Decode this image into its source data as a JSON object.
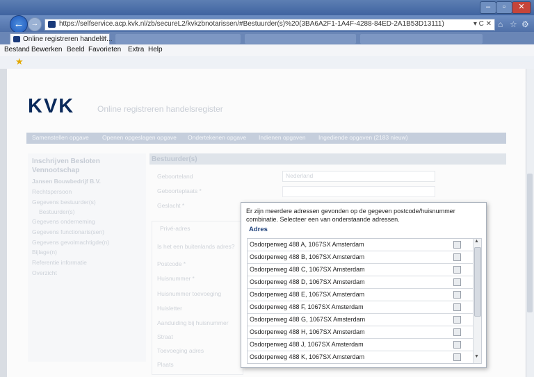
{
  "browser": {
    "url": "https://selfservice.acp.kvk.nl/zb/secureL2/kvkzbnotarissen/#Bestuurder(s)%20(3BA6A2F1-1A4F-4288-84ED-2A1B53D13111)",
    "url_controls": "▾ C ✕",
    "tab_title": "Online registreren handelsr...",
    "menu": [
      "Bestand",
      "Bewerken",
      "Beeld",
      "Favorieten",
      "Extra",
      "Help"
    ]
  },
  "header": {
    "logo": "KVK",
    "subtitle": "Online registreren handelsregister"
  },
  "steps": [
    "Samenstellen opgave",
    "Openen opgeslagen opgave",
    "Ondertekenen opgave",
    "Indienen opgaven",
    "Ingediende opgaven (2183 nieuw)"
  ],
  "left_panel": {
    "heading": "Inschrijven Besloten Vennootschap",
    "items": [
      "Jansen Bouwbedrijf B.V.",
      "Rechtspersoon",
      "Gegevens bestuurder(s)",
      "Bestuurder(s)",
      "Gegevens onderneming",
      "Gegevens functionaris(sen)",
      "Gegevens gevolmachtigde(n)",
      "Bijlage(n)",
      "Referentie informatie",
      "Overzicht"
    ]
  },
  "form": {
    "section_title": "Bestuurder(s)",
    "labels": [
      "Geboorteland",
      "Geboorteplaats *",
      "Geslacht *",
      "Privé-adres",
      "Is het een buitenlands adres?",
      "Postcode *",
      "Huisnummer *",
      "Huisnummer toevoeging",
      "Huisletter",
      "Aanduiding bij huisnummer",
      "Straat",
      "Toevoeging adres",
      "Plaats"
    ],
    "geboorteland_value": "Nederland"
  },
  "popup": {
    "message": "Er zijn meerdere adressen gevonden op de gegeven postcode/huisnummer combinatie. Selecteer een van onderstaande adressen.",
    "column_header": "Adres",
    "addresses": [
      "Osdorperweg 488 A, 1067SX Amsterdam",
      "Osdorperweg 488 B, 1067SX Amsterdam",
      "Osdorperweg 488 C, 1067SX Amsterdam",
      "Osdorperweg 488 D, 1067SX Amsterdam",
      "Osdorperweg 488 E, 1067SX Amsterdam",
      "Osdorperweg 488 F, 1067SX Amsterdam",
      "Osdorperweg 488 G, 1067SX Amsterdam",
      "Osdorperweg 488 H, 1067SX Amsterdam",
      "Osdorperweg 488 J, 1067SX Amsterdam",
      "Osdorperweg 488 K, 1067SX Amsterdam"
    ]
  },
  "colors": {
    "brand": "#0b2a5b",
    "popup_header": "#1c3f7a",
    "browser_frame": "#4f70a8"
  },
  "icons": [
    "back-arrow-icon",
    "forward-arrow-icon",
    "favicon-icon",
    "home-icon",
    "favorites-star-icon",
    "settings-gear-icon",
    "favorites-bar-star-icon",
    "select-address-icon",
    "scroll-up-icon",
    "scroll-down-icon"
  ]
}
